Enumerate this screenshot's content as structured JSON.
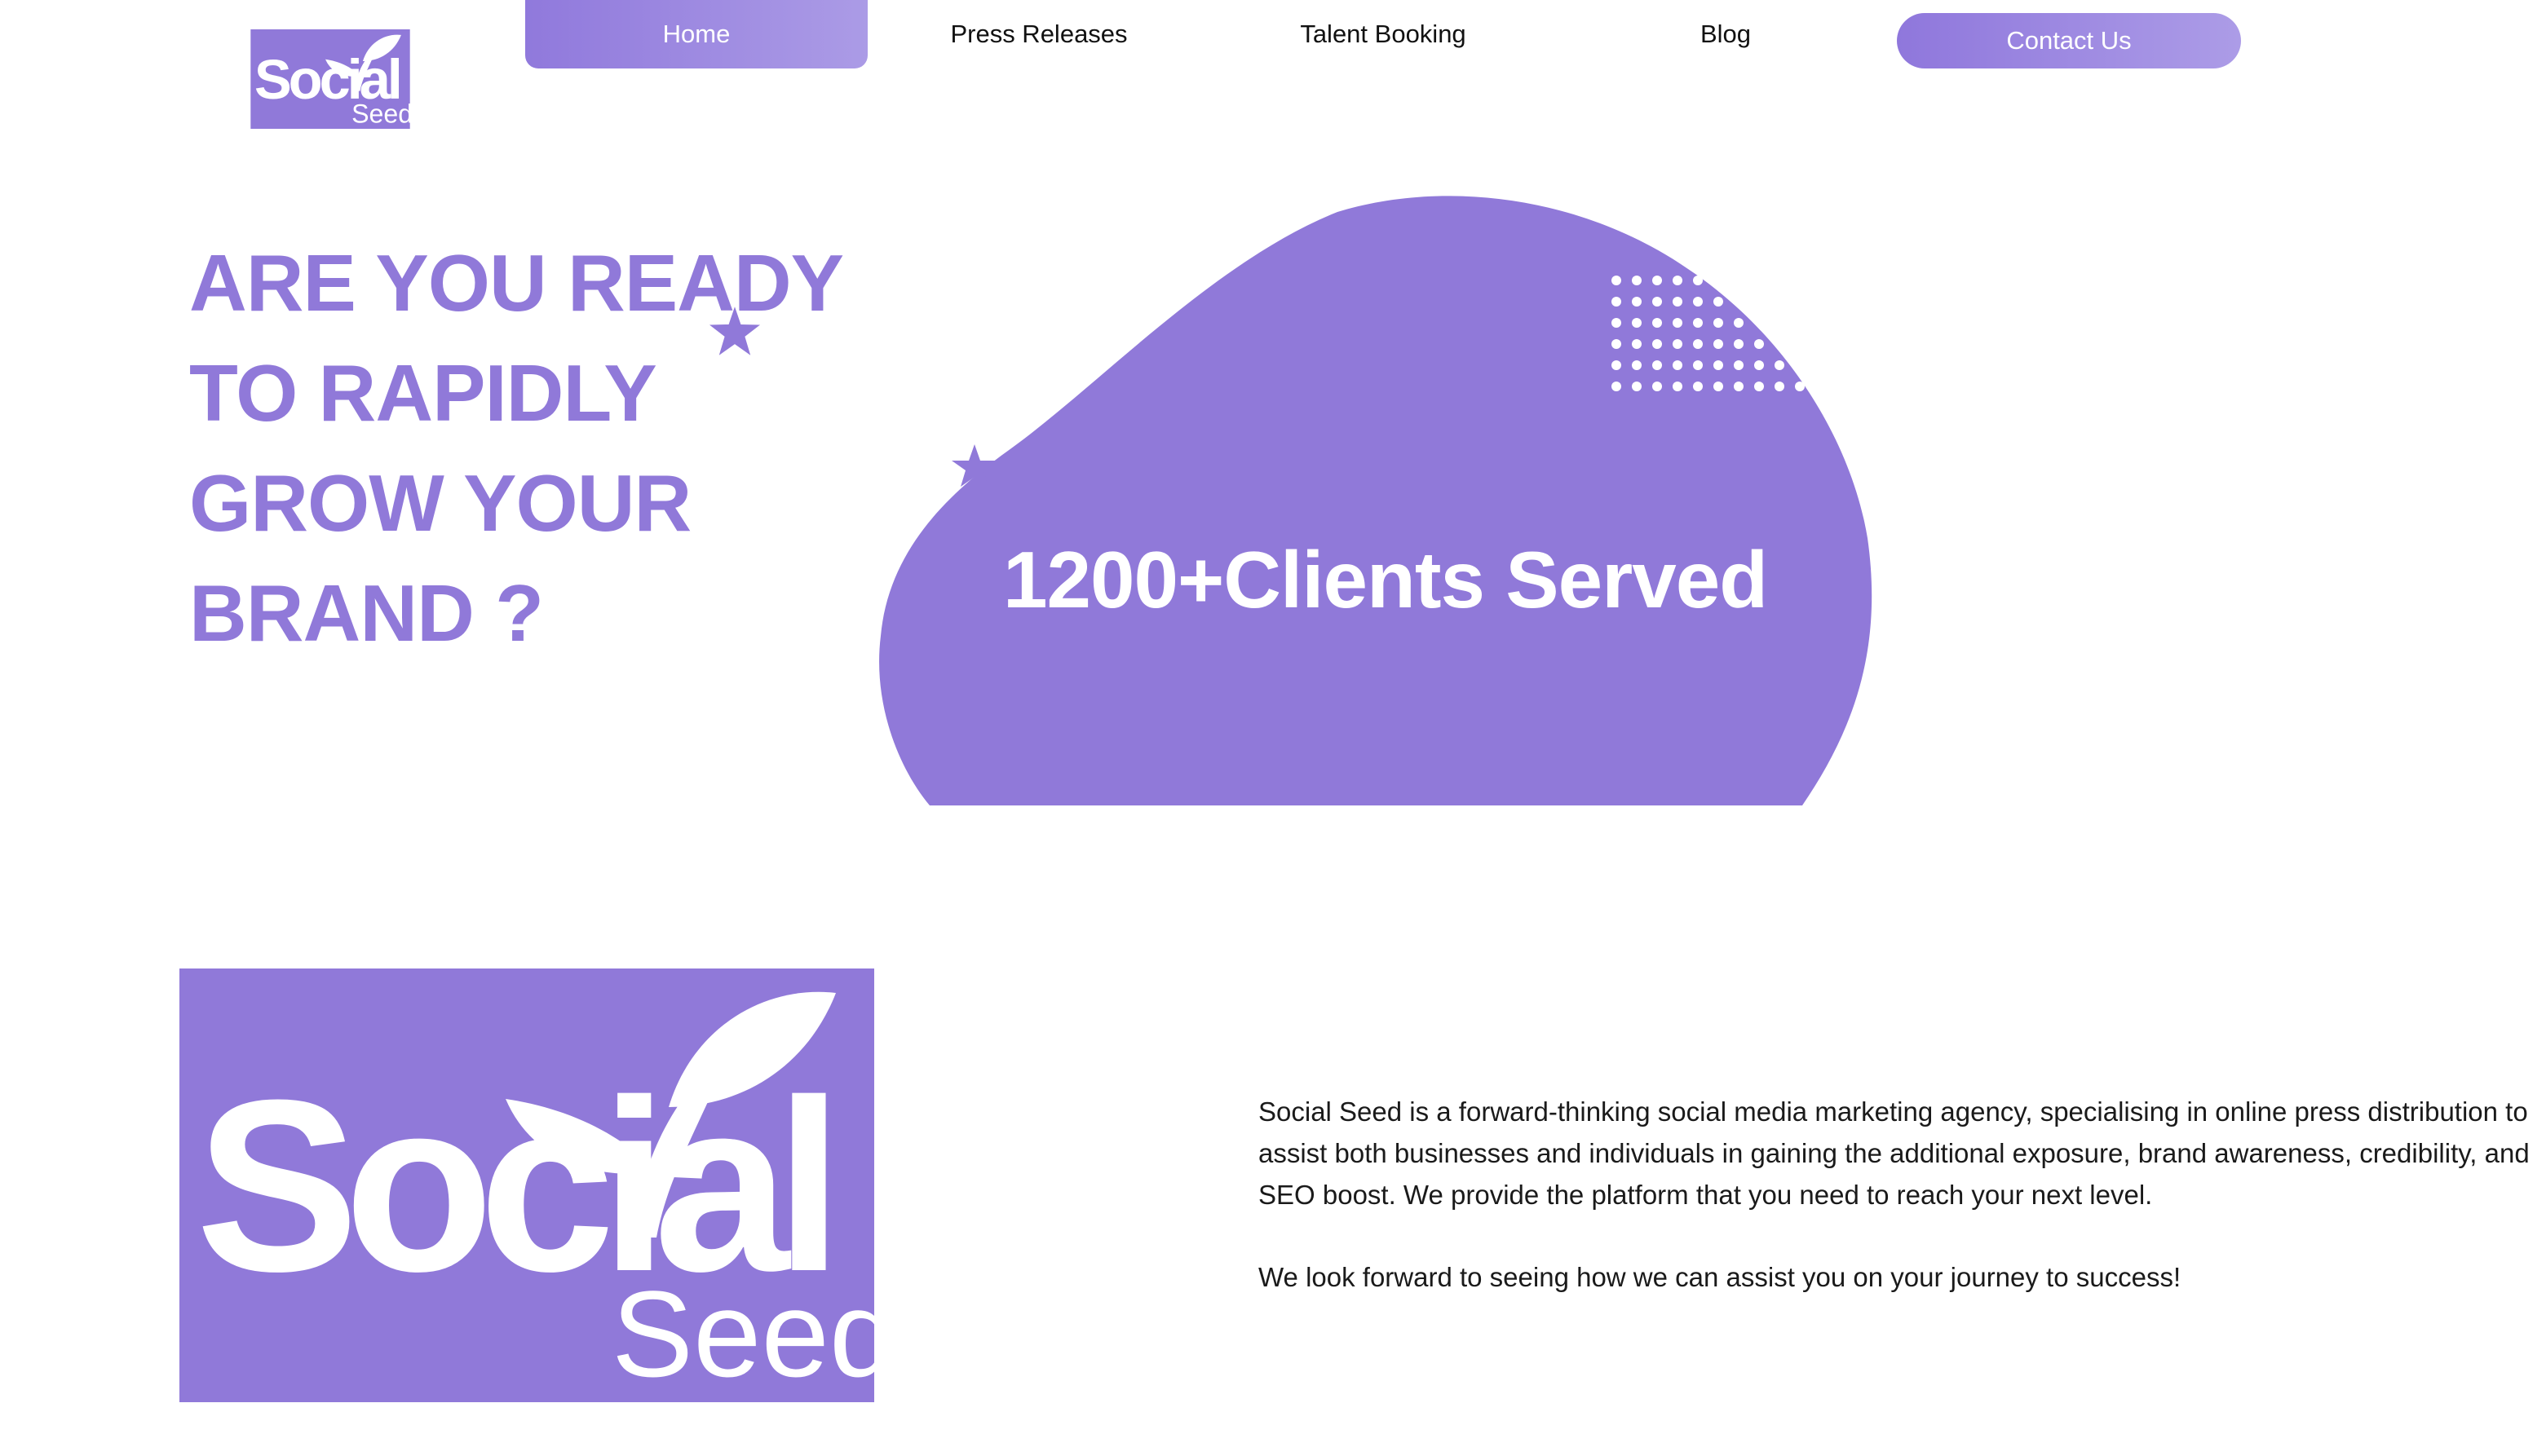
{
  "brand": {
    "logo_word": "Social",
    "logo_sub": "Seed",
    "color": "#9079d9"
  },
  "nav": {
    "home": "Home",
    "press_releases": "Press Releases",
    "talent_booking": "Talent Booking",
    "blog": "Blog",
    "contact": "Contact Us",
    "active": "Home"
  },
  "hero": {
    "heading_lines": [
      "ARE YOU READY",
      "TO RAPIDLY",
      "GROW YOUR",
      "BRAND ?"
    ],
    "stat": "1200+Clients Served"
  },
  "about": {
    "paragraph_1": "Social Seed is a forward-thinking social media marketing agency, specialising in online press distribution to assist both businesses and individuals in gaining the additional exposure, brand awareness, credibility, and SEO boost. We provide the platform that you need to reach your next level.",
    "paragraph_2": "We look forward to seeing how we can assist you on your journey to success!"
  },
  "icons": [
    "star-icon",
    "sprout-icon"
  ]
}
